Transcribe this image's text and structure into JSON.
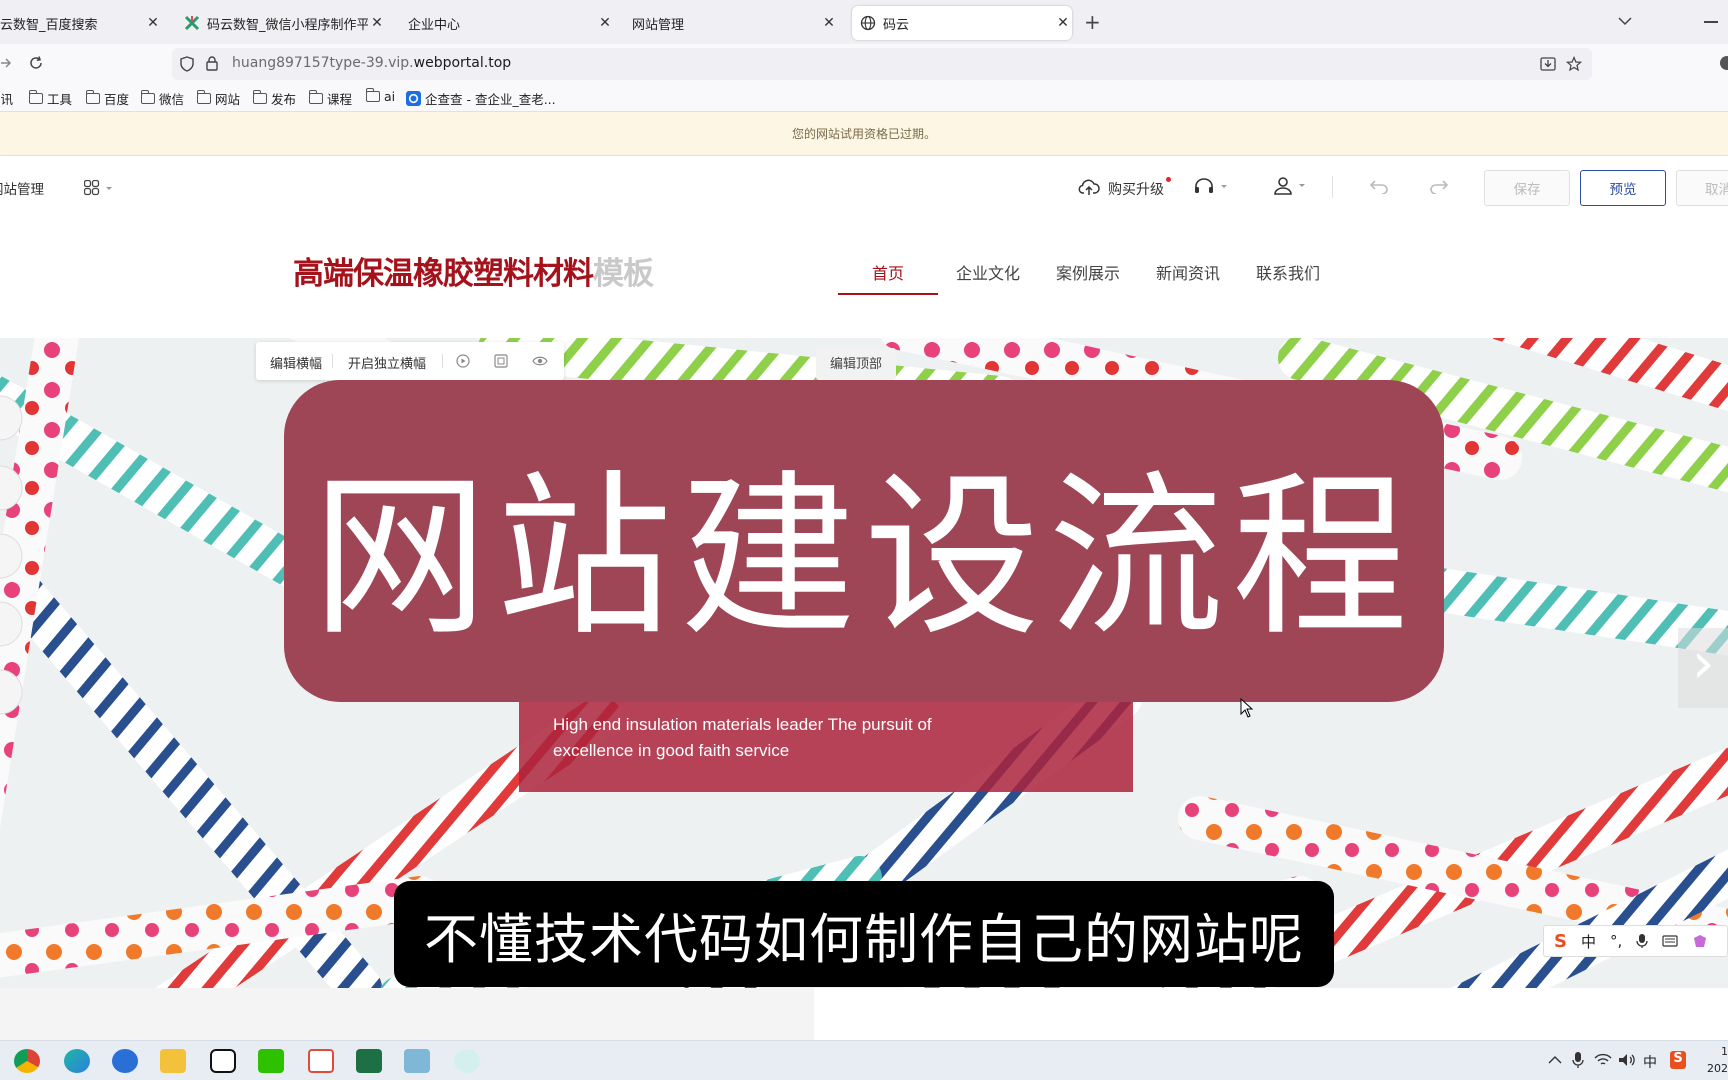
{
  "browser": {
    "tabs": [
      {
        "label": "云数智_百度搜索",
        "active": false
      },
      {
        "label": "码云数智_微信小程序制作平台_",
        "active": false
      },
      {
        "label": "企业中心",
        "active": false
      },
      {
        "label": "网站管理",
        "active": false
      },
      {
        "label": "码云",
        "active": true
      }
    ],
    "new_tab": "+",
    "url_prefix": "huang897157type-39.vip.",
    "url_domain": "webportal.top",
    "bookmarks": [
      "资讯",
      "工具",
      "百度",
      "微信",
      "网站",
      "发布",
      "课程",
      "ai",
      "企查查 - 查企业_查老..."
    ]
  },
  "notice": "您的网站试用资格已过期。",
  "editor": {
    "site_manage": "网站管理",
    "purchase": "购买升级",
    "save": "保存",
    "preview": "预览",
    "cancel": "取消"
  },
  "site": {
    "logo_main": "高端保温橡胶塑料材料",
    "logo_suffix": "模板",
    "nav": [
      "首页",
      "企业文化",
      "案例展示",
      "新闻资讯",
      "联系我们"
    ],
    "active_nav": "首页"
  },
  "banner": {
    "toolbar": {
      "edit_banner": "编辑横幅",
      "independent_banner": "开启独立横幅"
    },
    "edit_top": "编辑顶部",
    "overlay_title": "网站建设流程",
    "subtitle": "High end insulation materials leader The pursuit of excellence in good faith service",
    "caption": "不懂技术代码如何制作自己的网站呢",
    "next_arrow": "›"
  },
  "ime_bar": {
    "lang": "中"
  },
  "taskbar": {
    "tray_lang": "中",
    "time": "1",
    "date": "202"
  },
  "colors": {
    "brand_red": "#a5121b",
    "overlay": "#9e4556",
    "accent_blue": "#2d4ca7"
  }
}
